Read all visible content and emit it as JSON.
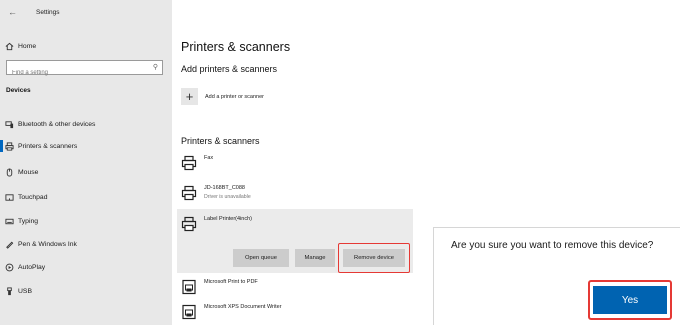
{
  "colors": {
    "accent": "#0067c0",
    "highlight": "#e53935",
    "yes_button": "#0063b1"
  },
  "window": {
    "title": "Settings",
    "back_icon": "back-arrow-icon"
  },
  "sidebar": {
    "home_label": "Home",
    "search_placeholder": "Find a setting",
    "section_header": "Devices",
    "items": [
      {
        "label": "Bluetooth & other devices",
        "icon": "bluetooth-devices-icon"
      },
      {
        "label": "Printers & scanners",
        "icon": "printer-icon",
        "active": true
      },
      {
        "label": "Mouse",
        "icon": "mouse-icon"
      },
      {
        "label": "Touchpad",
        "icon": "touchpad-icon"
      },
      {
        "label": "Typing",
        "icon": "keyboard-icon"
      },
      {
        "label": "Pen & Windows Ink",
        "icon": "pen-icon"
      },
      {
        "label": "AutoPlay",
        "icon": "autoplay-icon"
      },
      {
        "label": "USB",
        "icon": "usb-icon"
      }
    ]
  },
  "main": {
    "title": "Printers & scanners",
    "add_section": {
      "header": "Add printers & scanners",
      "add_label": "Add a printer or scanner"
    },
    "list_header": "Printers & scanners",
    "printers": [
      {
        "name": "Fax",
        "status": ""
      },
      {
        "name": "JD-168BT_C088",
        "status": "Driver is unavailable"
      },
      {
        "name": "Label Printer(4inch)",
        "status": ""
      },
      {
        "name": "Microsoft Print to PDF",
        "status": ""
      },
      {
        "name": "Microsoft XPS Document Writer",
        "status": ""
      }
    ],
    "actions": {
      "open_queue": "Open queue",
      "manage": "Manage",
      "remove_device": "Remove device"
    }
  },
  "dialog": {
    "message": "Are you sure you want to remove this device?",
    "yes_label": "Yes"
  }
}
